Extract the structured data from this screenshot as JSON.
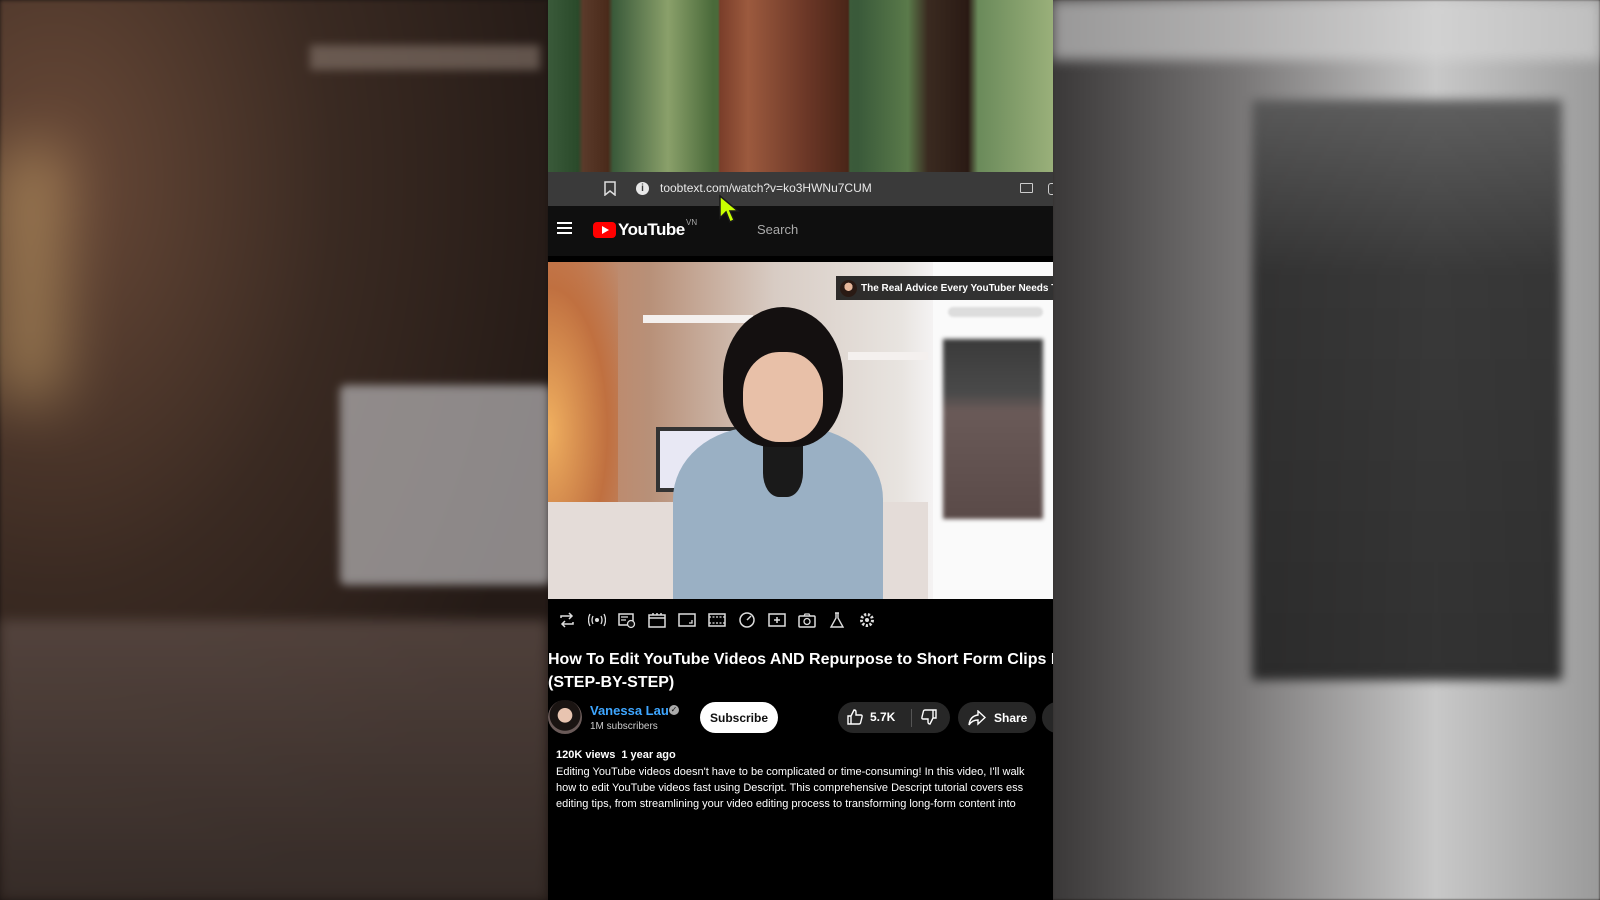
{
  "browser": {
    "url": "toobtext.com/watch?v=ko3HWNu7CUM"
  },
  "youtube": {
    "logo_text": "YouTube",
    "country_code": "VN",
    "search_placeholder": "Search"
  },
  "player": {
    "overlay_title": "The Real Advice Every YouTuber Needs To"
  },
  "toolbar": {
    "icons": [
      "loop-icon",
      "audio-icon",
      "screenshot-list-icon",
      "cinema-icon",
      "resize-icon",
      "frames-icon",
      "speed-icon",
      "add-clip-icon",
      "camera-icon",
      "lab-icon",
      "settings-icon"
    ]
  },
  "video": {
    "title_line1": "How To Edit YouTube Videos AND Repurpose to Short Form Clips Fo",
    "title_line2": "(STEP-BY-STEP)"
  },
  "channel": {
    "name": "Vanessa Lau",
    "subscribers": "1M subscribers",
    "subscribe_label": "Subscribe"
  },
  "actions": {
    "likes": "5.7K",
    "share_label": "Share"
  },
  "description": {
    "views": "120K views",
    "age": "1 year ago",
    "line1": "Editing YouTube videos doesn't have to be complicated or time-consuming! In this video, I'll walk",
    "line2": "how to edit YouTube videos fast using Descript. This comprehensive Descript tutorial covers ess",
    "line3": "editing tips, from streamlining your video editing process to transforming long-form content into"
  },
  "colors": {
    "yt_red": "#ff0000",
    "link_blue": "#3ea6ff",
    "cursor": "#c8ff00"
  }
}
